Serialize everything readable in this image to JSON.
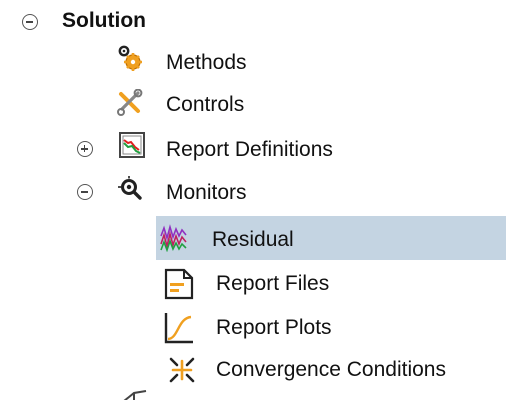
{
  "tree": {
    "solution": {
      "label": "Solution",
      "expanded": true,
      "icon": "collapse-icon"
    },
    "methods": {
      "label": "Methods",
      "icon": "methods-gear-icon"
    },
    "controls": {
      "label": "Controls",
      "icon": "controls-wrench-icon"
    },
    "report_definitions": {
      "label": "Report Definitions",
      "expanded": false,
      "icon": "report-definitions-icon"
    },
    "monitors": {
      "label": "Monitors",
      "expanded": true,
      "icon": "monitors-magnifier-icon"
    },
    "residual": {
      "label": "Residual",
      "selected": true,
      "icon": "residual-plot-icon"
    },
    "report_files": {
      "label": "Report Files",
      "icon": "report-file-icon"
    },
    "report_plots": {
      "label": "Report Plots",
      "icon": "report-plot-icon"
    },
    "convergence_conditions": {
      "label": "Convergence Conditions",
      "icon": "convergence-icon"
    }
  },
  "colors": {
    "selection": "#c4d4e2",
    "gear": "#f0a020",
    "report_red": "#e02020",
    "report_green": "#20a040",
    "plot_blue": "#1060c0"
  }
}
